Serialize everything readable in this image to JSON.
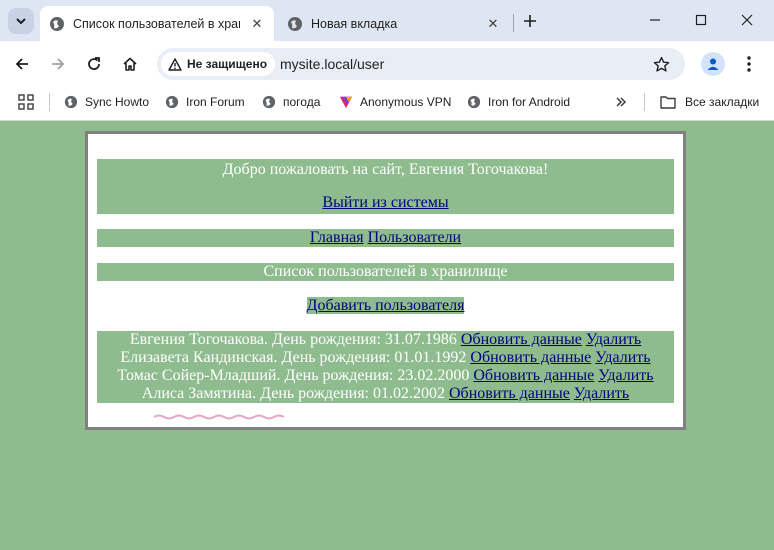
{
  "browser": {
    "tabs": [
      {
        "title": "Список пользователей в храни",
        "active": true
      },
      {
        "title": "Новая вкладка",
        "active": false
      }
    ],
    "omnibox": {
      "security_label": "Не защищено",
      "url": "mysite.local/user"
    },
    "bookmarks": [
      {
        "label": "Sync Howto",
        "icon": "globe-icon"
      },
      {
        "label": "Iron Forum",
        "icon": "globe-icon"
      },
      {
        "label": "погода",
        "icon": "globe-icon"
      },
      {
        "label": "Anonymous VPN",
        "icon": "vpn-icon"
      },
      {
        "label": "Iron for Android",
        "icon": "globe-icon"
      }
    ],
    "all_bookmarks_label": "Все закладки"
  },
  "page": {
    "welcome_text": "Добро пожаловать на сайт, Евгения Тогочакова!",
    "logout_link": "Выйти из системы",
    "nav": {
      "home": "Главная",
      "users": "Пользователи"
    },
    "list_title": "Список пользователей в хранилище",
    "add_user_link": "Добавить пользователя",
    "users": [
      {
        "text": "Евгения Тогочакова. День рождения: 31.07.1986",
        "update": "Обновить данные",
        "delete": "Удалить"
      },
      {
        "text": "Елизавета Кандинская. День рождения: 01.01.1992",
        "update": "Обновить данные",
        "delete": "Удалить"
      },
      {
        "text": "Томас Сойер-Младший. День рождения: 23.02.2000",
        "update": "Обновить данные",
        "delete": "Удалить"
      },
      {
        "text": "Алиса Замятина. День рождения: 01.02.2002",
        "update": "Обновить данные",
        "delete": "Удалить"
      }
    ]
  },
  "colors": {
    "page_background": "#8fbc8f",
    "link": "#000080",
    "container_border": "#808080"
  }
}
